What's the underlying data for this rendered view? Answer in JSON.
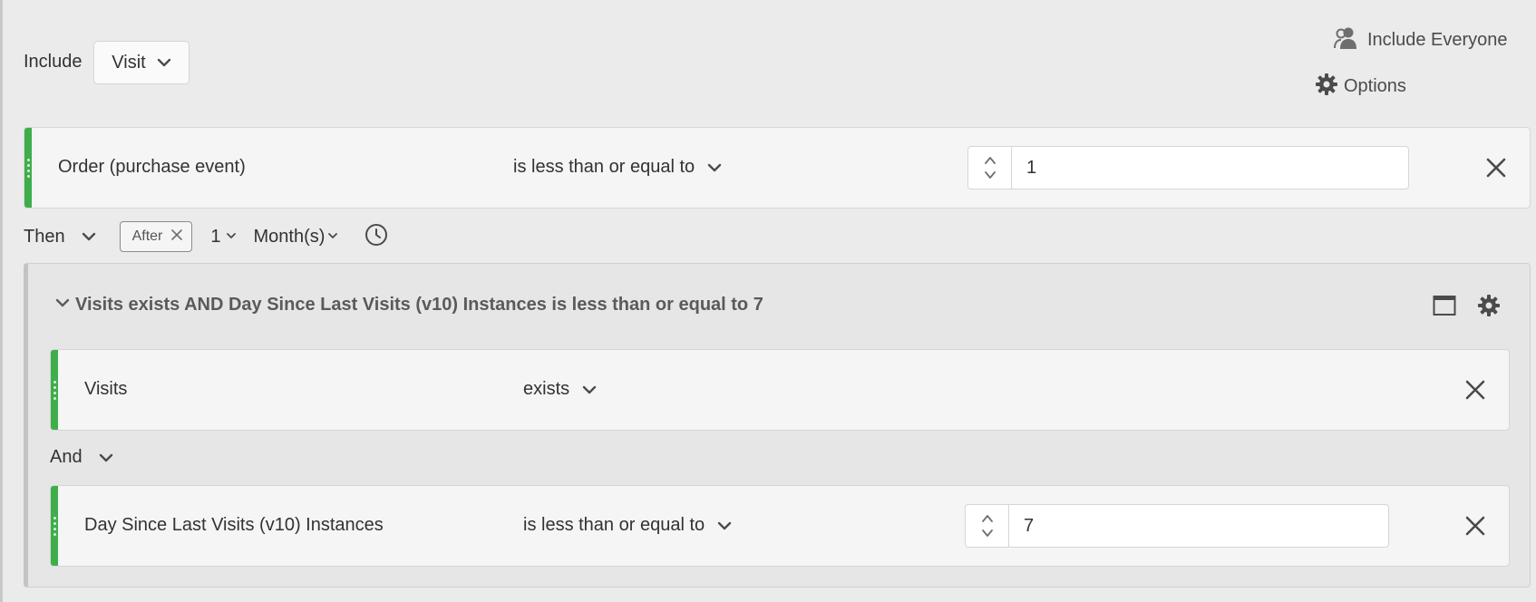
{
  "header": {
    "include_label": "Include",
    "container_select": "Visit",
    "include_everyone_label": "Include Everyone",
    "options_label": "Options"
  },
  "rule1": {
    "dimension": "Order (purchase event)",
    "operator": "is less than or equal to",
    "value": "1"
  },
  "sequence": {
    "then_label": "Then",
    "after_label": "After",
    "count": "1",
    "unit": "Month(s)"
  },
  "container": {
    "title": "Visits exists AND Day Since Last Visits (v10) Instances is less than or equal to 7",
    "rule_a": {
      "dimension": "Visits",
      "operator": "exists"
    },
    "logic_operator": "And",
    "rule_b": {
      "dimension": "Day Since Last Visits (v10) Instances",
      "operator": "is less than or equal to",
      "value": "7"
    }
  },
  "colors": {
    "handle_green": "#3eae4a",
    "background": "#ebebeb",
    "rule_background": "#f5f5f5"
  },
  "icons": [
    "people-icon",
    "gear-icon",
    "chevron-down-icon",
    "close-icon",
    "clock-icon",
    "stepper-icon",
    "window-icon"
  ]
}
